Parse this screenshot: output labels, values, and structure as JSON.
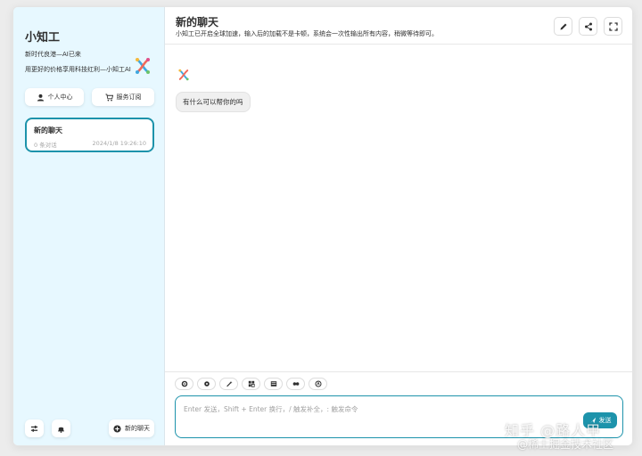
{
  "sidebar": {
    "app_title": "小知工",
    "tagline_1": "新时代良港—AI已来",
    "tagline_2": "用更好的价格享用科技红利—小知工AI",
    "personal_center_label": "个人中心",
    "subscribe_label": "服务订阅",
    "chat": {
      "title": "新的聊天",
      "count": "0 条对话",
      "time": "2024/1/8 19:26:10"
    },
    "new_chat_label": "新的聊天"
  },
  "header": {
    "title": "新的聊天",
    "subtitle": "小知工已开启全球加速，输入后的加载不是卡顿，系统会一次性输出所有内容，稍微等待即可。"
  },
  "messages": [
    {
      "role": "assistant",
      "text": "有什么可以帮你的吗"
    }
  ],
  "input": {
    "placeholder": "Enter 发送，Shift + Enter 换行，/ 触发补全，: 触发命令",
    "send_label": "发送",
    "toolbar_icons": [
      "settings-icon",
      "theme-icon",
      "magic-wand-icon",
      "prompt-grid-icon",
      "mask-icon",
      "clear-icon",
      "robot-icon",
      "hand-icon"
    ]
  },
  "watermark": {
    "line1": "知乎 @路人甲",
    "line2": "@稀土掘金技术社区"
  },
  "colors": {
    "accent": "#1d93ab",
    "sidebar_bg": "#e7f8ff"
  }
}
